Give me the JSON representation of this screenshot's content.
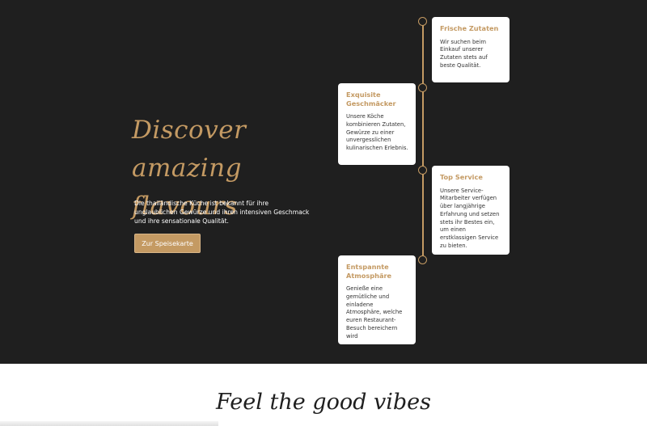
{
  "hero": {
    "title": "Discover amazing flavours",
    "text": "Die thailändische Küche ist bekannt für ihre unglaublichen Gewürze und ihren intensiven Geschmack und ihre sensationale Qualität.",
    "button_label": "Zur Speisekarte",
    "accent_color": "#c49a63",
    "background_color": "#1f1f1f"
  },
  "timeline": {
    "items": [
      {
        "title": "Frische Zutaten",
        "text": "Wir suchen beim Einkauf unserer Zutaten stets auf beste Qualität."
      },
      {
        "title": "Exquisite Geschmäcker",
        "text": "Unsere Köche kombinieren Zutaten, Gewürze zu einer unvergesslichen kulinarischen Erlebnis."
      },
      {
        "title": "Top Service",
        "text": "Unsere Service-Mitarbeiter verfügen über langjährige Erfahrung und setzen stets ihr Bestes ein, um einen erstklassigen Service zu bieten."
      },
      {
        "title": "Entspannte Atmosphäre",
        "text": "Genieße eine gemütliche und einladene Atmosphäre, welche euren Restaurant-Besuch bereichern wird"
      }
    ]
  },
  "section2": {
    "title": "Feel the good vibes"
  }
}
